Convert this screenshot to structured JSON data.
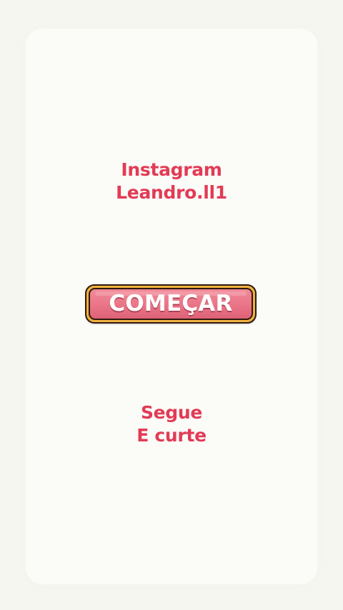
{
  "promo": {
    "line1": "Instagram",
    "line2": "Leandro.ll1"
  },
  "start_button": {
    "label": "COMEÇAR"
  },
  "call_to_action": {
    "line1": "Segue",
    "line2": "E curte"
  }
}
